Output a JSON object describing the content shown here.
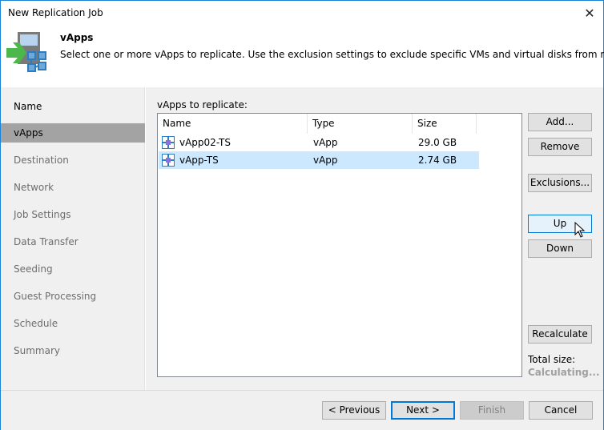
{
  "window": {
    "title": "New Replication Job",
    "close_icon": "close-icon"
  },
  "header": {
    "icon": "replication-vapp-icon",
    "title": "vApps",
    "description": "Select one or more vApps to replicate. Use the exclusion settings to exclude specific VMs and virtual disks from replication."
  },
  "sidebar": {
    "items": [
      {
        "label": "Name",
        "state": "done"
      },
      {
        "label": "vApps",
        "state": "active"
      },
      {
        "label": "Destination",
        "state": "pending"
      },
      {
        "label": "Network",
        "state": "pending"
      },
      {
        "label": "Job Settings",
        "state": "pending"
      },
      {
        "label": "Data Transfer",
        "state": "pending"
      },
      {
        "label": "Seeding",
        "state": "pending"
      },
      {
        "label": "Guest Processing",
        "state": "pending"
      },
      {
        "label": "Schedule",
        "state": "pending"
      },
      {
        "label": "Summary",
        "state": "pending"
      }
    ]
  },
  "main": {
    "list_label": "vApps to replicate:",
    "columns": [
      "Name",
      "Type",
      "Size"
    ],
    "rows": [
      {
        "name": "vApp02-TS",
        "type": "vApp",
        "size": "29.0 GB",
        "icon": "vapp-icon",
        "selected": false
      },
      {
        "name": "vApp-TS",
        "type": "vApp",
        "size": "2.74 GB",
        "icon": "vapp-icon",
        "selected": true
      }
    ],
    "buttons": {
      "add": "Add...",
      "remove": "Remove",
      "exclusions": "Exclusions...",
      "up": "Up",
      "down": "Down",
      "recalculate": "Recalculate"
    },
    "total_size_label": "Total size:",
    "total_size_value": "Calculating..."
  },
  "footer": {
    "previous": "< Previous",
    "next": "Next >",
    "finish": "Finish",
    "cancel": "Cancel"
  },
  "colors": {
    "accent": "#0078d7",
    "selected_row": "#cce8ff",
    "active_nav": "#a3a3a3"
  }
}
